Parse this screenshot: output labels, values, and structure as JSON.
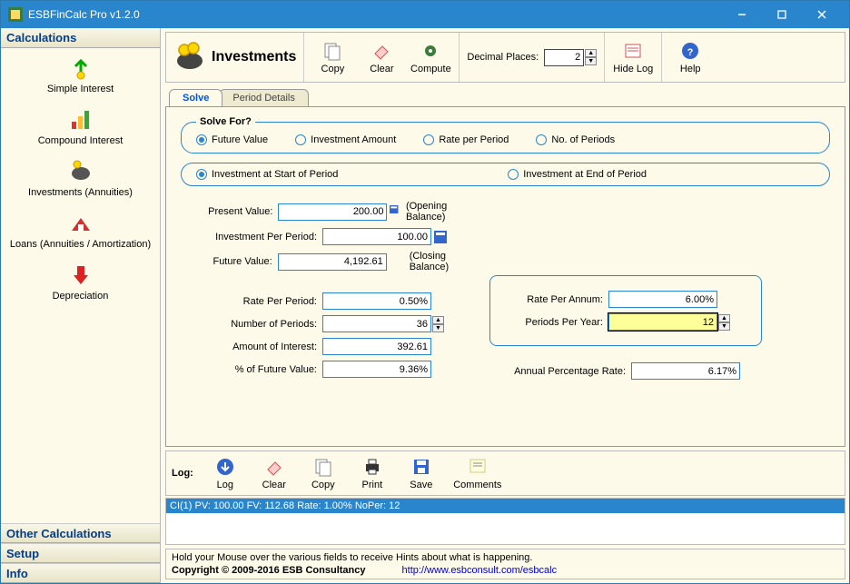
{
  "window": {
    "title": "ESBFinCalc Pro v1.2.0"
  },
  "sidebar": {
    "header": "Calculations",
    "items": [
      {
        "label": "Simple Interest"
      },
      {
        "label": "Compound Interest"
      },
      {
        "label": "Investments (Annuities)"
      },
      {
        "label": "Loans (Annuities / Amortization)"
      },
      {
        "label": "Depreciation"
      }
    ],
    "footer": [
      "Other Calculations",
      "Setup",
      "Info"
    ]
  },
  "toolbar": {
    "title": "Investments",
    "copy": "Copy",
    "clear": "Clear",
    "compute": "Compute",
    "decimal_label": "Decimal Places:",
    "decimal_value": "2",
    "hidelog": "Hide Log",
    "help": "Help"
  },
  "tabs": {
    "solve": "Solve",
    "period": "Period Details"
  },
  "solve": {
    "legend": "Solve For?",
    "radios": {
      "fv": "Future Value",
      "ia": "Investment Amount",
      "rpp": "Rate per Period",
      "nop": "No. of Periods"
    },
    "timing": {
      "start": "Investment at Start of Period",
      "end": "Investment at End of Period"
    },
    "fields": {
      "pv_label": "Present Value:",
      "pv": "200.00",
      "pv_hint": "(Opening Balance)",
      "ipp_label": "Investment Per Period:",
      "ipp": "100.00",
      "fv_label": "Future Value:",
      "fv": "4,192.61",
      "fv_hint": "(Closing Balance)",
      "rpp_label": "Rate Per Period:",
      "rpp": "0.50%",
      "nper_label": "Number of Periods:",
      "nper": "36",
      "aoi_label": "Amount of Interest:",
      "aoi": "392.61",
      "pofv_label": "% of Future Value:",
      "pofv": "9.36%",
      "rpa_label": "Rate Per Annum:",
      "rpa": "6.00%",
      "ppy_label": "Periods Per Year:",
      "ppy": "12",
      "apr_label": "Annual Percentage Rate:",
      "apr": "6.17%"
    }
  },
  "logbar": {
    "label": "Log:",
    "log": "Log",
    "clear": "Clear",
    "copy": "Copy",
    "print": "Print",
    "save": "Save",
    "comments": "Comments"
  },
  "log": {
    "line1": "CI(1) PV: 100.00 FV: 112.68 Rate: 1.00% NoPer: 12"
  },
  "status": {
    "hint": "Hold your Mouse over the various fields to receive Hints about what is happening.",
    "copyright": "Copyright © 2009-2016 ESB Consultancy",
    "url": "http://www.esbconsult.com/esbcalc"
  }
}
